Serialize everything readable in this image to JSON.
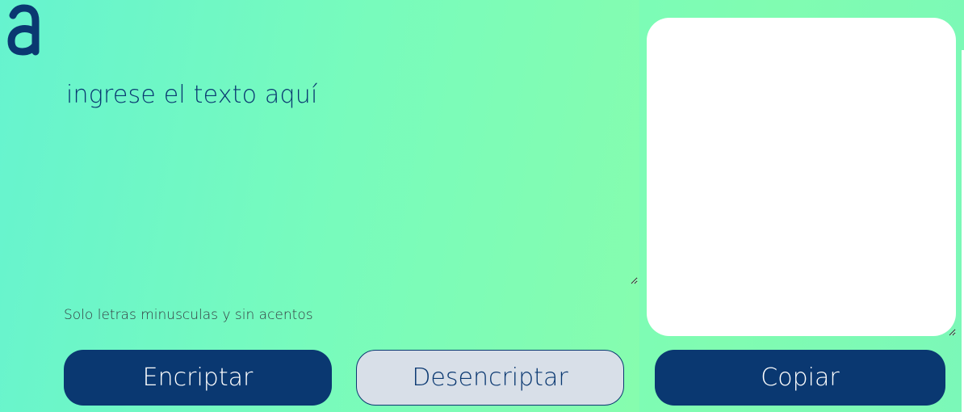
{
  "logo": {
    "icon": "alura-logo-icon",
    "color": "#0a3871"
  },
  "input": {
    "placeholder": "ingrese el texto aquí",
    "value": ""
  },
  "hint": {
    "text": "Solo letras minusculas y sin acentos"
  },
  "buttons": {
    "encrypt_label": "Encriptar",
    "decrypt_label": "Desencriptar",
    "copy_label": "Copiar"
  },
  "output": {
    "value": ""
  },
  "colors": {
    "primary": "#0a3871",
    "secondary_button_bg": "#d8dfe8",
    "background_gradient_start": "#62f0d0",
    "background_gradient_end": "#80fcb1",
    "output_bg": "#ffffff"
  }
}
